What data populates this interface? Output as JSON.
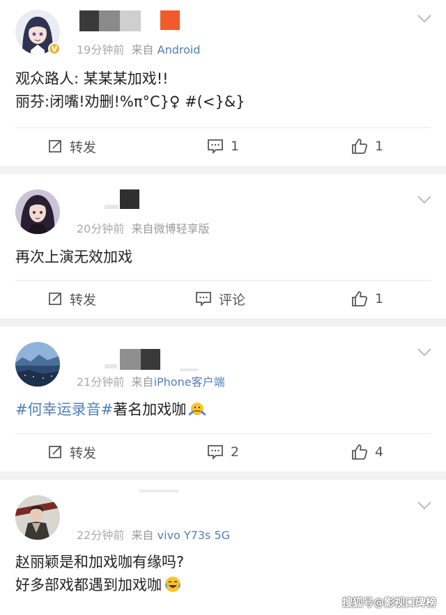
{
  "comments": [
    {
      "meta_time": "19分钟前",
      "meta_source_prefix": "来自",
      "meta_source": "Android",
      "lines": [
        "观众路人: 某某某加戏!!",
        "丽芬:闭嘴!劝删!%π°C}♀ #(<}&}"
      ],
      "actions": {
        "repost": "转发",
        "comment": "1",
        "like": "1"
      }
    },
    {
      "meta_time": "20分钟前",
      "meta_source_prefix": "来自",
      "meta_source": "微博轻享版",
      "lines": [
        "再次上演无效加戏"
      ],
      "actions": {
        "repost": "转发",
        "comment": "评论",
        "like": "1"
      }
    },
    {
      "meta_time": "21分钟前",
      "meta_source_prefix": "来自",
      "meta_source": "iPhone客户端",
      "topic": "#何幸运录音#",
      "lines": [
        "著名加戏咖"
      ],
      "actions": {
        "repost": "转发",
        "comment": "2",
        "like": "4"
      }
    },
    {
      "meta_time": "22分钟前",
      "meta_source_prefix": "来自",
      "meta_source": "vivo Y73s 5G",
      "lines": [
        "赵丽颖是和加戏咖有缘吗?",
        "好多部戏都遇到加戏咖"
      ]
    }
  ],
  "watermark": "搜狐号@影视口碑榜",
  "verified_badge": "V",
  "icons": [
    "repost-icon",
    "comment-icon",
    "like-icon",
    "chevron-down-icon",
    "verified-badge-icon"
  ],
  "colors": {
    "link": "#4f7fb8",
    "meta": "#999999",
    "background": "#f2f2f2"
  }
}
